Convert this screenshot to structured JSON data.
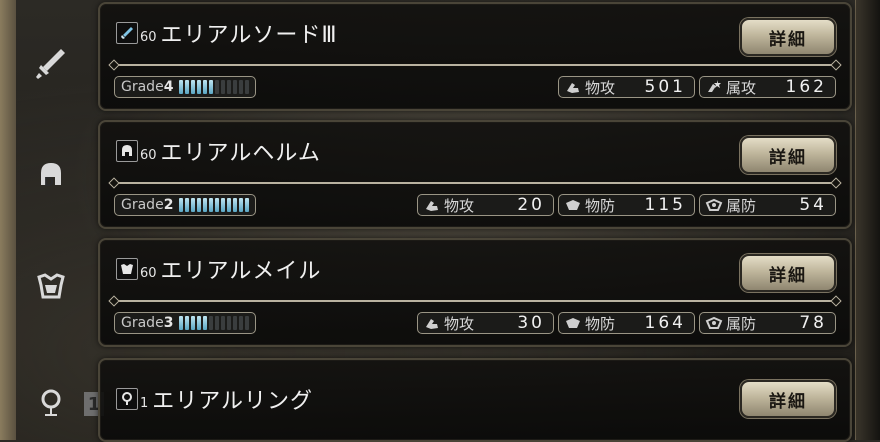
{
  "sidebar": {
    "ring_count": "1"
  },
  "items": [
    {
      "icon": "sword-icon",
      "level": "60",
      "name": "エリアルソードⅢ",
      "detail_label": "詳細",
      "grade_label": "Grade",
      "grade_num": "4",
      "grade_fraction": 0.5,
      "stats": [
        {
          "icon": "physical-attack-icon",
          "label": "物攻",
          "value": "501"
        },
        {
          "icon": "element-attack-icon",
          "label": "属攻",
          "value": "162"
        }
      ]
    },
    {
      "icon": "helm-icon",
      "level": "60",
      "name": "エリアルヘルム",
      "detail_label": "詳細",
      "grade_label": "Grade",
      "grade_num": "2",
      "grade_fraction": 1.0,
      "stats": [
        {
          "icon": "physical-attack-icon",
          "label": "物攻",
          "value": "20"
        },
        {
          "icon": "physical-defense-icon",
          "label": "物防",
          "value": "115"
        },
        {
          "icon": "element-defense-icon",
          "label": "属防",
          "value": "54"
        }
      ]
    },
    {
      "icon": "armor-icon",
      "level": "60",
      "name": "エリアルメイル",
      "detail_label": "詳細",
      "grade_label": "Grade",
      "grade_num": "3",
      "grade_fraction": 0.417,
      "stats": [
        {
          "icon": "physical-attack-icon",
          "label": "物攻",
          "value": "30"
        },
        {
          "icon": "physical-defense-icon",
          "label": "物防",
          "value": "164"
        },
        {
          "icon": "element-defense-icon",
          "label": "属防",
          "value": "78"
        }
      ]
    },
    {
      "icon": "ring-icon",
      "level": "1",
      "name": "エリアルリング",
      "detail_label": "詳細"
    }
  ],
  "colors": {
    "grade_bar_on": "#5aa7c4",
    "grade_bar_off": "#3a3d3e",
    "button": "#d6cdb3"
  }
}
